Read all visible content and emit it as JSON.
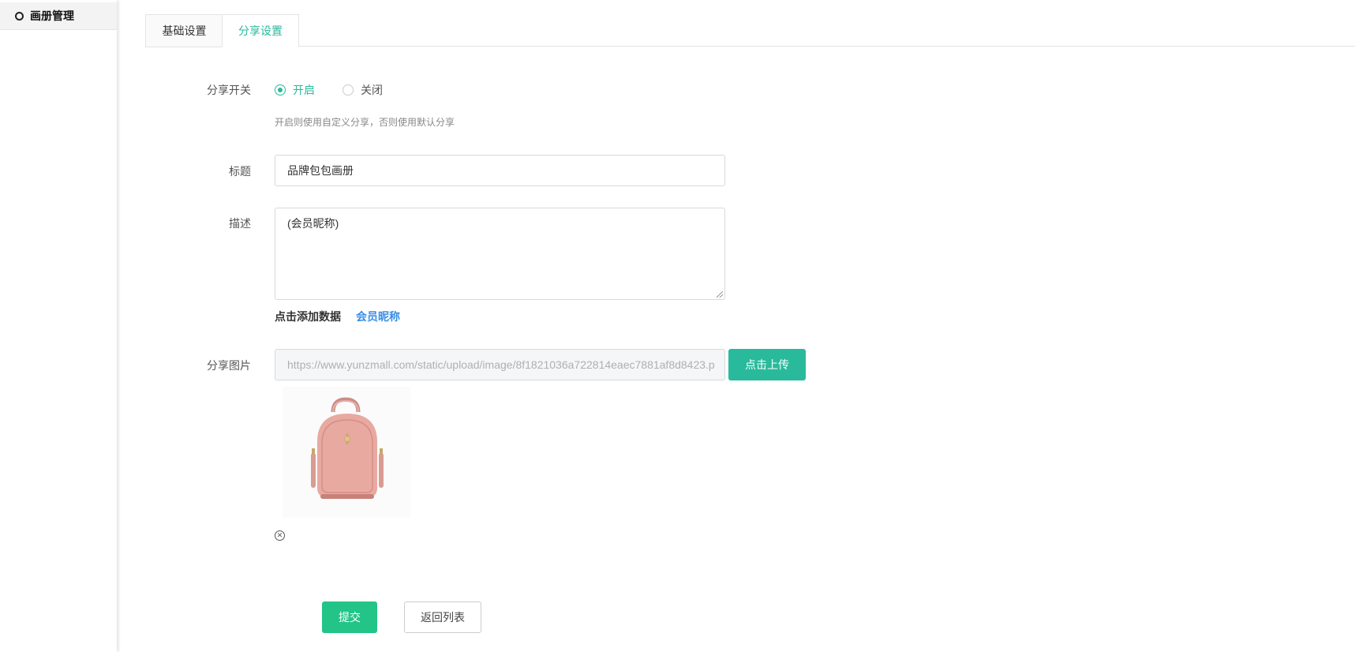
{
  "sidebar": {
    "items": [
      {
        "label": "画册管理"
      }
    ]
  },
  "tabs": [
    {
      "label": "基础设置"
    },
    {
      "label": "分享设置"
    }
  ],
  "form": {
    "share_switch": {
      "label": "分享开关",
      "options": [
        {
          "label": "开启",
          "selected": true
        },
        {
          "label": "关闭",
          "selected": false
        }
      ],
      "hint": "开启则使用自定义分享，否则使用默认分享"
    },
    "title": {
      "label": "标题",
      "value": "品牌包包画册"
    },
    "description": {
      "label": "描述",
      "value": "(会员昵称)"
    },
    "add_data": {
      "label": "点击添加数据",
      "link": "会员昵称"
    },
    "share_image": {
      "label": "分享图片",
      "url": "https://www.yunzmall.com/static/upload/image/8f1821036a722814eaec7881af8d8423.p",
      "upload_label": "点击上传"
    }
  },
  "actions": {
    "submit_label": "提交",
    "back_label": "返回列表"
  },
  "colors": {
    "accent": "#29ba9c",
    "submit": "#23c488",
    "link": "#3a8ee6"
  }
}
